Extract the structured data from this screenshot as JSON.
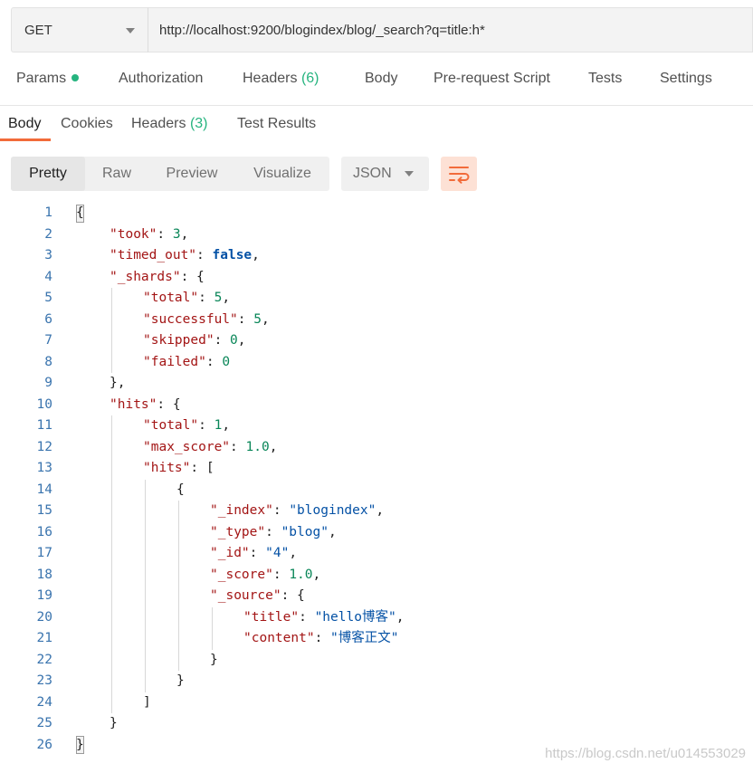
{
  "request": {
    "method": "GET",
    "url": "http://localhost:9200/blogindex/blog/_search?q=title:h*"
  },
  "request_tabs": [
    {
      "label": "Params",
      "has_dot": true
    },
    {
      "label": "Authorization"
    },
    {
      "label": "Headers",
      "count": "(6)"
    },
    {
      "label": "Body"
    },
    {
      "label": "Pre-request Script"
    },
    {
      "label": "Tests"
    },
    {
      "label": "Settings"
    }
  ],
  "response_tabs": [
    {
      "label": "Body",
      "active": true
    },
    {
      "label": "Cookies"
    },
    {
      "label": "Headers",
      "count": "(3)"
    },
    {
      "label": "Test Results"
    }
  ],
  "view_modes": [
    "Pretty",
    "Raw",
    "Preview",
    "Visualize"
  ],
  "active_view_mode": "Pretty",
  "language": "JSON",
  "wrap_icon": "wrap-lines-icon",
  "colors": {
    "accent": "#f26b3a",
    "count_green": "#26b47f",
    "json_key": "#a31515",
    "json_string": "#0451a5",
    "json_number": "#098658",
    "line_number": "#3a74ae"
  },
  "response_lines": [
    {
      "n": "1",
      "indent": 0,
      "parts": [
        [
          "p",
          "{"
        ]
      ]
    },
    {
      "n": "2",
      "indent": 1,
      "parts": [
        [
          "k",
          "\"took\""
        ],
        [
          "p",
          ": "
        ],
        [
          "n",
          "3"
        ],
        [
          "p",
          ","
        ]
      ]
    },
    {
      "n": "3",
      "indent": 1,
      "parts": [
        [
          "k",
          "\"timed_out\""
        ],
        [
          "p",
          ": "
        ],
        [
          "b",
          "false"
        ],
        [
          "p",
          ","
        ]
      ]
    },
    {
      "n": "4",
      "indent": 1,
      "parts": [
        [
          "k",
          "\"_shards\""
        ],
        [
          "p",
          ": {"
        ]
      ]
    },
    {
      "n": "5",
      "indent": 2,
      "parts": [
        [
          "k",
          "\"total\""
        ],
        [
          "p",
          ": "
        ],
        [
          "n",
          "5"
        ],
        [
          "p",
          ","
        ]
      ]
    },
    {
      "n": "6",
      "indent": 2,
      "parts": [
        [
          "k",
          "\"successful\""
        ],
        [
          "p",
          ": "
        ],
        [
          "n",
          "5"
        ],
        [
          "p",
          ","
        ]
      ]
    },
    {
      "n": "7",
      "indent": 2,
      "parts": [
        [
          "k",
          "\"skipped\""
        ],
        [
          "p",
          ": "
        ],
        [
          "n",
          "0"
        ],
        [
          "p",
          ","
        ]
      ]
    },
    {
      "n": "8",
      "indent": 2,
      "parts": [
        [
          "k",
          "\"failed\""
        ],
        [
          "p",
          ": "
        ],
        [
          "n",
          "0"
        ]
      ]
    },
    {
      "n": "9",
      "indent": 1,
      "parts": [
        [
          "p",
          "},"
        ]
      ]
    },
    {
      "n": "10",
      "indent": 1,
      "parts": [
        [
          "k",
          "\"hits\""
        ],
        [
          "p",
          ": {"
        ]
      ]
    },
    {
      "n": "11",
      "indent": 2,
      "parts": [
        [
          "k",
          "\"total\""
        ],
        [
          "p",
          ": "
        ],
        [
          "n",
          "1"
        ],
        [
          "p",
          ","
        ]
      ]
    },
    {
      "n": "12",
      "indent": 2,
      "parts": [
        [
          "k",
          "\"max_score\""
        ],
        [
          "p",
          ": "
        ],
        [
          "n",
          "1.0"
        ],
        [
          "p",
          ","
        ]
      ]
    },
    {
      "n": "13",
      "indent": 2,
      "parts": [
        [
          "k",
          "\"hits\""
        ],
        [
          "p",
          ": ["
        ]
      ]
    },
    {
      "n": "14",
      "indent": 3,
      "parts": [
        [
          "p",
          "{"
        ]
      ]
    },
    {
      "n": "15",
      "indent": 4,
      "parts": [
        [
          "k",
          "\"_index\""
        ],
        [
          "p",
          ": "
        ],
        [
          "s",
          "\"blogindex\""
        ],
        [
          "p",
          ","
        ]
      ]
    },
    {
      "n": "16",
      "indent": 4,
      "parts": [
        [
          "k",
          "\"_type\""
        ],
        [
          "p",
          ": "
        ],
        [
          "s",
          "\"blog\""
        ],
        [
          "p",
          ","
        ]
      ]
    },
    {
      "n": "17",
      "indent": 4,
      "parts": [
        [
          "k",
          "\"_id\""
        ],
        [
          "p",
          ": "
        ],
        [
          "s",
          "\"4\""
        ],
        [
          "p",
          ","
        ]
      ]
    },
    {
      "n": "18",
      "indent": 4,
      "parts": [
        [
          "k",
          "\"_score\""
        ],
        [
          "p",
          ": "
        ],
        [
          "n",
          "1.0"
        ],
        [
          "p",
          ","
        ]
      ]
    },
    {
      "n": "19",
      "indent": 4,
      "parts": [
        [
          "k",
          "\"_source\""
        ],
        [
          "p",
          ": {"
        ]
      ]
    },
    {
      "n": "20",
      "indent": 5,
      "parts": [
        [
          "k",
          "\"title\""
        ],
        [
          "p",
          ": "
        ],
        [
          "s",
          "\"hello博客\""
        ],
        [
          "p",
          ","
        ]
      ]
    },
    {
      "n": "21",
      "indent": 5,
      "parts": [
        [
          "k",
          "\"content\""
        ],
        [
          "p",
          ": "
        ],
        [
          "s",
          "\"博客正文\""
        ]
      ]
    },
    {
      "n": "22",
      "indent": 4,
      "parts": [
        [
          "p",
          "}"
        ]
      ]
    },
    {
      "n": "23",
      "indent": 3,
      "parts": [
        [
          "p",
          "}"
        ]
      ]
    },
    {
      "n": "24",
      "indent": 2,
      "parts": [
        [
          "p",
          "]"
        ]
      ]
    },
    {
      "n": "25",
      "indent": 1,
      "parts": [
        [
          "p",
          "}"
        ]
      ]
    },
    {
      "n": "26",
      "indent": 0,
      "parts": [
        [
          "p",
          "}"
        ]
      ]
    }
  ],
  "watermark": "https://blog.csdn.net/u014553029"
}
